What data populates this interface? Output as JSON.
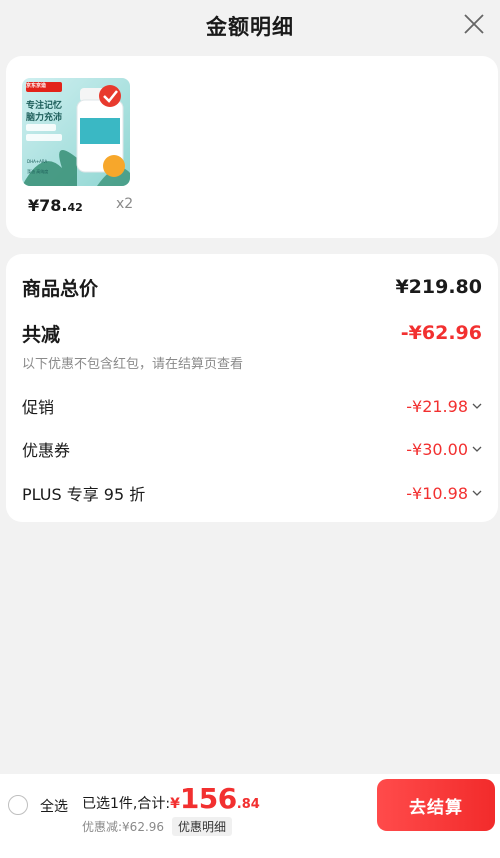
{
  "header": {
    "title": "金额明细"
  },
  "product": {
    "image_brand": "京东京造",
    "image_tagline_1": "专注记忆",
    "image_tagline_2": "脑力充沛",
    "image_tag_1": "DHA+ARA",
    "image_tag_2": "藻油 高纯度",
    "price_main": "¥78.",
    "price_decimal": "42",
    "quantity": "x2"
  },
  "details": {
    "total_label": "商品总价",
    "total_value": "¥219.80",
    "reduce_label": "共减",
    "reduce_value": "-¥62.96",
    "note": "以下优惠不包含红包，请在结算页查看",
    "items": [
      {
        "label": "促销",
        "value": "-¥21.98"
      },
      {
        "label": "优惠券",
        "value": "-¥30.00"
      },
      {
        "label": "PLUS 专享 95 折",
        "value": "-¥10.98"
      }
    ]
  },
  "bottom": {
    "select_all": "全选",
    "summary_text": "已选1件,合计:",
    "currency": "¥",
    "total_int": "156",
    "total_dec": ".84",
    "savings": "优惠减:¥62.96",
    "detail_link": "优惠明细",
    "checkout": "去结算"
  },
  "colors": {
    "accent": "#f23030",
    "muted": "#8a8a8a"
  },
  "icons": [
    "close-icon",
    "chevron-down-icon",
    "radio-icon",
    "checkmark-badge-icon"
  ]
}
